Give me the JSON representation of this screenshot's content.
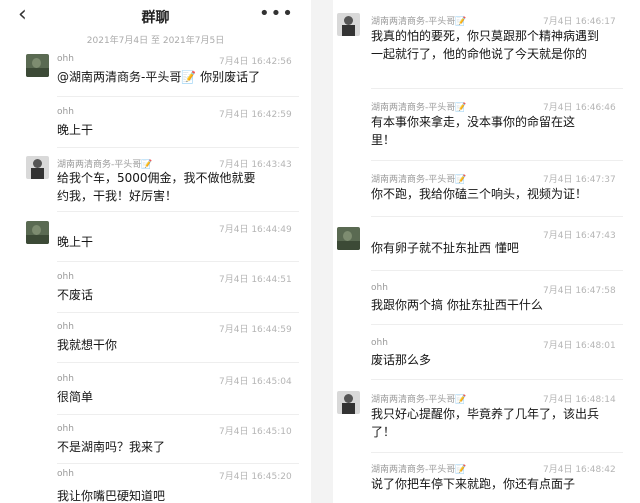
{
  "header": {
    "title": "群聊",
    "back_icon": "chevron-left-icon",
    "more_icon": "more-dots-icon"
  },
  "date_range": "2021年7月4日 至 2021年7月5日",
  "left_messages": [
    {
      "name": "ohh",
      "time": "7月4日 16:42:56",
      "text": "@湖南两清商务-平头哥📝 你别废话了"
    },
    {
      "name": "ohh",
      "time": "7月4日 16:42:59",
      "text": "晚上干"
    },
    {
      "name": "湖南两清商务-平头哥📝",
      "time": "7月4日 16:43:43",
      "text": "给我个车，5000佣金，我不做他就要约我，干我！好厉害！"
    },
    {
      "name": "",
      "time": "7月4日 16:44:49",
      "text": "晚上干"
    },
    {
      "name": "ohh",
      "time": "7月4日 16:44:51",
      "text": "不废话"
    },
    {
      "name": "ohh",
      "time": "7月4日 16:44:59",
      "text": "我就想干你"
    },
    {
      "name": "ohh",
      "time": "7月4日 16:45:04",
      "text": "很简单"
    },
    {
      "name": "ohh",
      "time": "7月4日 16:45:10",
      "text": "不是湖南吗？我来了"
    },
    {
      "name": "ohh",
      "time": "7月4日 16:45:20",
      "text": "我让你嘴巴硬知道吧"
    }
  ],
  "right_messages": [
    {
      "name": "湖南两清商务-平头哥📝",
      "time": "7月4日 16:46:17",
      "text": "我真的怕的要死，你只莫跟那个精神病遇到一起就行了，他的命他说了今天就是你的"
    },
    {
      "name": "湖南两清商务-平头哥📝",
      "time": "7月4日 16:46:46",
      "text": "有本事你来拿走，没本事你的命留在这里！"
    },
    {
      "name": "湖南两清商务-平头哥📝",
      "time": "7月4日 16:47:37",
      "text": "你不跑，我给你磕三个响头，视频为证！"
    },
    {
      "name": "",
      "time": "7月4日 16:47:43",
      "text": "你有卵子就不扯东扯西 懂吧"
    },
    {
      "name": "ohh",
      "time": "7月4日 16:47:58",
      "text": "我跟你两个搞 你扯东扯西干什么"
    },
    {
      "name": "ohh",
      "time": "7月4日 16:48:01",
      "text": "废话那么多"
    },
    {
      "name": "湖南两清商务-平头哥📝",
      "time": "7月4日 16:48:14",
      "text": "我只好心提醒你，毕竟养了几年了，该出兵了！"
    },
    {
      "name": "湖南两清商务-平头哥📝",
      "time": "7月4日 16:48:42",
      "text": "说了你把车停下来就跑，你还有点面子"
    }
  ]
}
